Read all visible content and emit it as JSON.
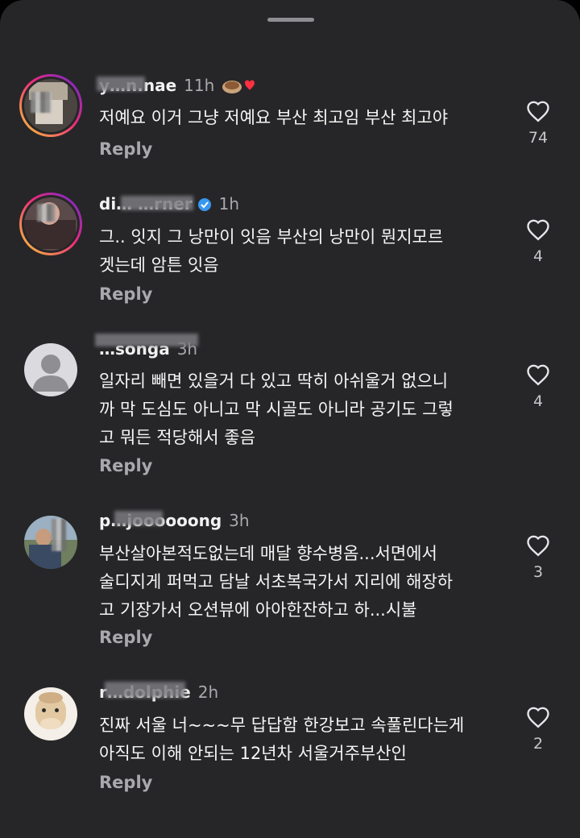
{
  "comments": [
    {
      "username": "y…n.nae",
      "time": "11h",
      "text": "저예요 이거 그냥 저예요 부산 최고임 부산 최고야",
      "reply_label": "Reply",
      "likes": "74",
      "avatar_story": true
    },
    {
      "username": "di… …rner",
      "time": "1h",
      "text": "그.. 잇지 그 낭만이 잇음 부산의 낭만이 뭔지모르\n겟는데 암튼 잇음",
      "reply_label": "Reply",
      "likes": "4",
      "avatar_story": true
    },
    {
      "username": "…songa",
      "time": "3h",
      "text": "일자리 빼면 있을거 다 있고 딱히 아쉬울거 없으니\n까 막 도심도 아니고 막 시골도 아니라 공기도 그렇\n고 뭐든 적당해서 좋음",
      "reply_label": "Reply",
      "likes": "4",
      "avatar_story": false
    },
    {
      "username": "p…joooooong",
      "time": "3h",
      "text": "부산살아본적도없는데 매달 향수병옴...서면에서\n술디지게 퍼먹고 담날 서초복국가서 지리에 해장하\n고 기장가서 오션뷰에 아아한잔하고 하...시불",
      "reply_label": "Reply",
      "likes": "3",
      "avatar_story": false
    },
    {
      "username": "r…dolphie",
      "time": "2h",
      "text": "진짜 서울 너~~~무 답답함 한강보고 속풀린다는게\n아직도 이해 안되는 12년차 서울거주부산인",
      "reply_label": "Reply",
      "likes": "2",
      "avatar_story": false
    }
  ],
  "icons": {
    "like": "heart-outline-icon",
    "verified": "verified-badge-icon",
    "reaction": "food-heart-emoji-icon"
  },
  "colors": {
    "sheet_bg": "#262628",
    "text": "#f5f5f5",
    "secondary": "#a8a8ad",
    "verified": "#3897f0"
  }
}
